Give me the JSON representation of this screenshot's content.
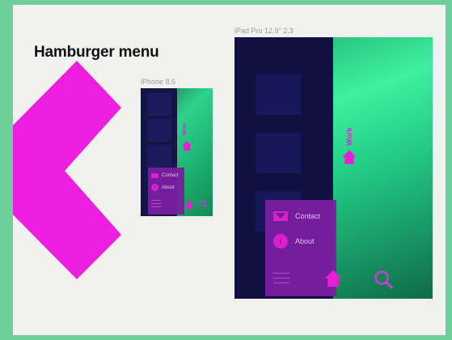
{
  "page": {
    "title": "Hamburger menu"
  },
  "frames": {
    "iphone": {
      "label": "iPhone 8.5",
      "menu": [
        {
          "label": "Contact",
          "icon": "mail-icon"
        },
        {
          "label": "About",
          "icon": "info-icon"
        }
      ]
    },
    "ipad": {
      "label": "iPad Pro 12.9\" 2.3",
      "side_label": "Work",
      "menu": [
        {
          "label": "Contact",
          "icon": "mail-icon"
        },
        {
          "label": "About",
          "icon": "info-icon"
        }
      ]
    }
  },
  "colors": {
    "accent": "#e61fd6",
    "menu_bg": "#7a1fa0",
    "canvas_bg": "#f1f1ef",
    "frame_bg": "#6fcf9a"
  },
  "icons": {
    "home": "home-icon",
    "search": "search-icon",
    "menu": "hamburger-icon",
    "info_glyph": "i"
  }
}
